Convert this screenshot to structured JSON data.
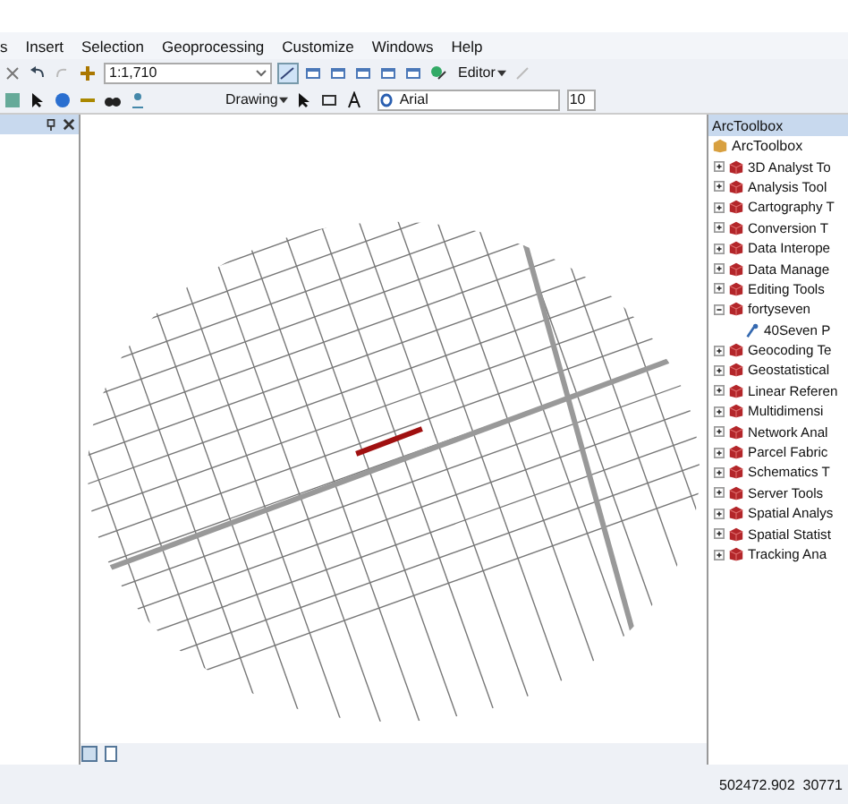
{
  "menu": [
    "s",
    "Insert",
    "Selection",
    "Geoprocessing",
    "Customize",
    "Windows",
    "Help"
  ],
  "toolbar": {
    "scale": "1:1,710",
    "editor": "Editor",
    "drawing": "Drawing",
    "font": "Arial",
    "font_size": "10"
  },
  "toolbox": {
    "title": "ArcToolbox",
    "root": "ArcToolbox",
    "items": [
      {
        "label": "3D Analyst To",
        "expanded": false
      },
      {
        "label": "Analysis Tool",
        "expanded": false
      },
      {
        "label": "Cartography T",
        "expanded": false
      },
      {
        "label": "Conversion T",
        "expanded": false
      },
      {
        "label": "Data Interope",
        "expanded": false
      },
      {
        "label": "Data Manage",
        "expanded": false
      },
      {
        "label": "Editing Tools",
        "expanded": false
      },
      {
        "label": "fortyseven",
        "expanded": true,
        "children": [
          {
            "label": "40Seven P"
          }
        ]
      },
      {
        "label": "Geocoding Te",
        "expanded": false
      },
      {
        "label": "Geostatistical",
        "expanded": false
      },
      {
        "label": "Linear Referen",
        "expanded": false
      },
      {
        "label": "Multidimensi",
        "expanded": false
      },
      {
        "label": "Network Anal",
        "expanded": false
      },
      {
        "label": "Parcel Fabric",
        "expanded": false
      },
      {
        "label": "Schematics T",
        "expanded": false
      },
      {
        "label": "Server Tools",
        "expanded": false
      },
      {
        "label": "Spatial Analys",
        "expanded": false
      },
      {
        "label": "Spatial Statist",
        "expanded": false
      },
      {
        "label": "Tracking Ana",
        "expanded": false
      }
    ]
  },
  "status_bar": {
    "coordinates": "502472.902  30771"
  }
}
